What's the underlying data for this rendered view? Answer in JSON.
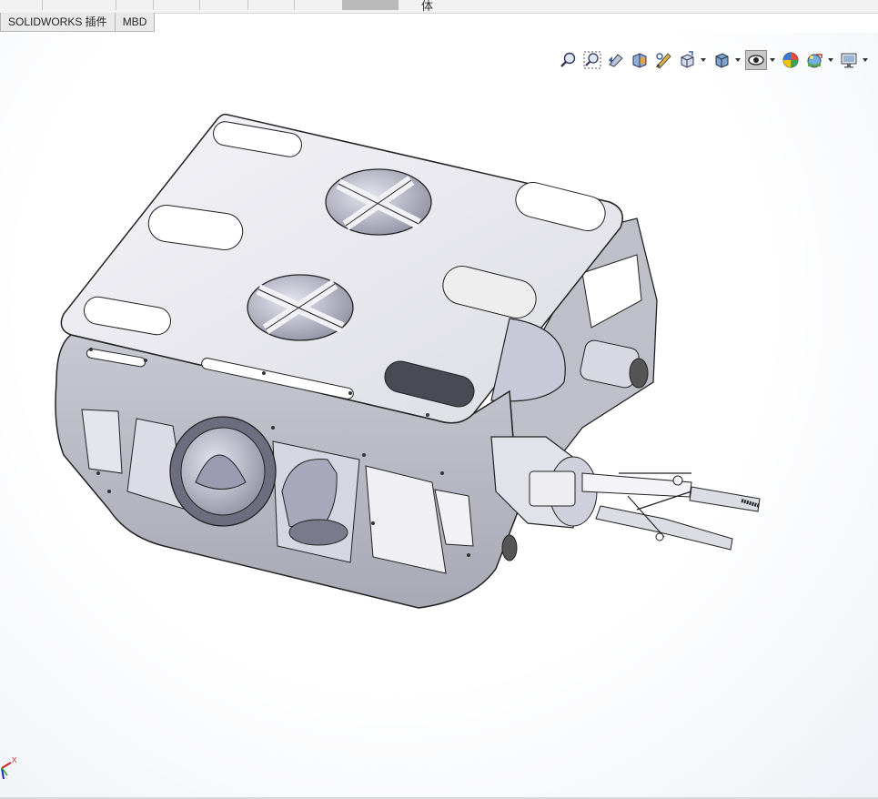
{
  "tabs": [
    {
      "label": "SOLIDWORKS 插件"
    },
    {
      "label": "MBD"
    }
  ],
  "top_strip": {
    "partial_text": "体"
  },
  "heads_up_toolbar": [
    {
      "icon": "zoom-to-fit-icon"
    },
    {
      "icon": "zoom-to-area-icon"
    },
    {
      "icon": "previous-view-icon"
    },
    {
      "icon": "section-view-icon"
    },
    {
      "icon": "dynamic-annotation-icon"
    },
    {
      "icon": "view-orientation-icon",
      "has_dropdown": true
    },
    {
      "icon": "display-style-icon",
      "has_dropdown": true
    },
    {
      "icon": "hide-show-items-icon",
      "has_dropdown": true,
      "active": true
    },
    {
      "icon": "edit-appearance-icon"
    },
    {
      "icon": "apply-scene-icon",
      "has_dropdown": true
    },
    {
      "icon": "view-settings-icon",
      "has_dropdown": true
    }
  ],
  "triad": {
    "x_label": "X"
  },
  "colors": {
    "toolbar_bg": "#f2f2f2",
    "tab_bg": "#e9e9e9",
    "active_button": "#c7c7c7",
    "model_metal": "#d4d4dc",
    "model_edge": "#2a2a2a"
  }
}
